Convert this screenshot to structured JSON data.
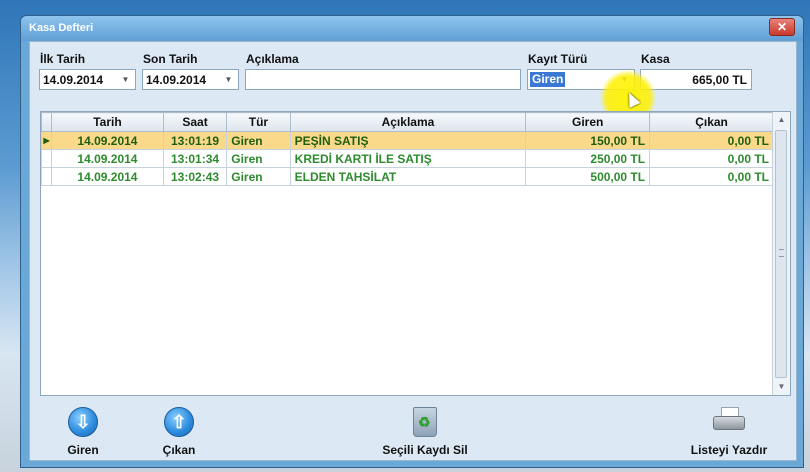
{
  "window": {
    "title": "Kasa Defteri",
    "close_glyph": "✕"
  },
  "filters": {
    "ilk_tarih_label": "İlk Tarih",
    "ilk_tarih_value": "14.09.2014",
    "son_tarih_label": "Son Tarih",
    "son_tarih_value": "14.09.2014",
    "aciklama_label": "Açıklama",
    "aciklama_value": "",
    "kayit_turu_label": "Kayıt Türü",
    "kayit_turu_value": "Giren",
    "kasa_label": "Kasa",
    "kasa_value": "665,00 TL"
  },
  "grid": {
    "columns": [
      "Tarih",
      "Saat",
      "Tür",
      "Açıklama",
      "Giren",
      "Çıkan"
    ],
    "rows": [
      {
        "tarih": "14.09.2014",
        "saat": "13:01:19",
        "tur": "Giren",
        "aciklama": "PEŞİN SATIŞ",
        "giren": "150,00 TL",
        "cikan": "0,00 TL"
      },
      {
        "tarih": "14.09.2014",
        "saat": "13:01:34",
        "tur": "Giren",
        "aciklama": "KREDİ KARTI İLE SATIŞ",
        "giren": "250,00 TL",
        "cikan": "0,00 TL"
      },
      {
        "tarih": "14.09.2014",
        "saat": "13:02:43",
        "tur": "Giren",
        "aciklama": "ELDEN TAHSİLAT",
        "giren": "500,00 TL",
        "cikan": "0,00 TL"
      }
    ]
  },
  "buttons": {
    "giren": "Giren",
    "cikan": "Çıkan",
    "secili_kaydi_sil": "Seçili Kaydı Sil",
    "listeyi_yazdir": "Listeyi Yazdır"
  },
  "colors": {
    "accent": "#6aa8d8",
    "selected_row": "#fbd98a",
    "row_text": "#2e8b2e"
  },
  "icons": [
    "close-icon",
    "chevron-down-icon",
    "arrow-down-circle-icon",
    "arrow-up-circle-icon",
    "recycle-bin-icon",
    "printer-icon"
  ]
}
